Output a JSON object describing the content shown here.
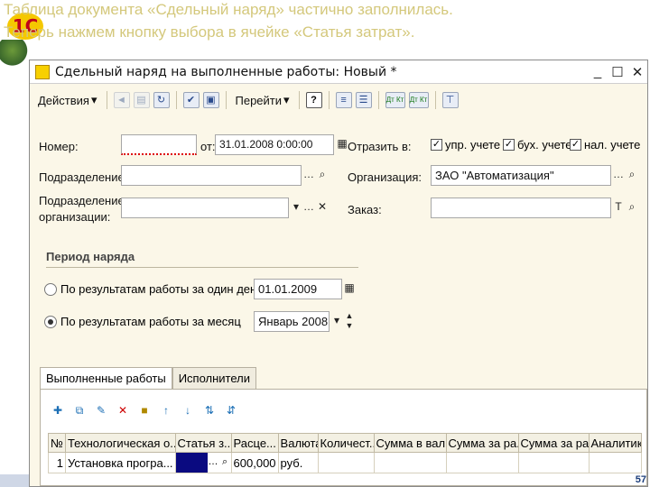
{
  "caption": {
    "line1": "Таблица документа «Сдельный наряд» частично заполнилась.",
    "line2": "Теперь нажмем кнопку выбора в ячейке «Статья затрат»."
  },
  "logo": "1С",
  "window": {
    "title": "Сдельный наряд на выполненные работы: Новый *",
    "min": "_",
    "max": "☐",
    "close": "✕"
  },
  "toolbar": {
    "actions": "Действия",
    "goto": "Перейти",
    "help": "?",
    "dt_kt_1": "Дт Кт",
    "dt_kt_2": "Дт Кт"
  },
  "form": {
    "number_label": "Номер:",
    "number_value": "",
    "date_label": "от:",
    "date_value": "31.01.2008  0:00:00",
    "reflect_label": "Отразить в:",
    "check_mgmt": "упр. учете",
    "check_acc": "бух. учете",
    "check_tax": "нал. учете",
    "division_label": "Подразделение:",
    "division_value": "",
    "organization_label": "Организация:",
    "organization_value": "ЗАО \"Автоматизация\"",
    "org_division_label1": "Подразделение",
    "org_division_label2": "организации:",
    "org_division_value": "",
    "order_label": "Заказ:",
    "order_value": ""
  },
  "period": {
    "title": "Период наряда",
    "day_option": "По результатам работы за один день",
    "day_value": "01.01.2009",
    "month_option": "По результатам работы за месяц",
    "month_value": "Январь 2008"
  },
  "tabs": [
    {
      "label": "Выполненные работы"
    },
    {
      "label": "Исполнители"
    }
  ],
  "table": {
    "headers": [
      "№",
      "Технологическая о...",
      "Статья з...",
      "Расце...",
      "Валюта",
      "Количест...",
      "Сумма в вал...",
      "Сумма за ра...",
      "Сумма за ра...",
      "Аналитик..."
    ],
    "rows": [
      [
        "1",
        "Установка програ...",
        "",
        "600,000",
        "руб.",
        "",
        "",
        "",
        "",
        ""
      ]
    ]
  },
  "page_number": "57"
}
